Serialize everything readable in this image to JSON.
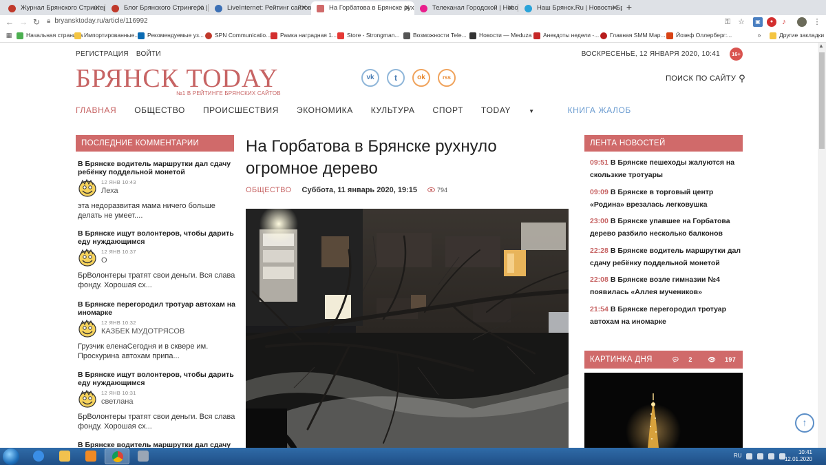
{
  "browser": {
    "tabs": [
      {
        "title": "Журнал Брянского Стрингера",
        "color": "#c0392b"
      },
      {
        "title": "Блог Брянского Стрингера | Янде",
        "color": "#c0392b"
      },
      {
        "title": "LiveInternet: Рейтинг сайтов",
        "color": "#3b6fb5"
      },
      {
        "title": "На Горбатова в Брянске рухнуло",
        "color": "#d06a6a"
      },
      {
        "title": "Телеканал Городской | Новости Бр",
        "color": "#e91e8c"
      },
      {
        "title": "Наш Брянск.Ru | Новости Брянск",
        "color": "#29a3d9"
      }
    ],
    "new_tab": "+",
    "url": "bryansktoday.ru/article/116992",
    "bookmarks": [
      {
        "label": "Начальная страница",
        "color": "#4caf50"
      },
      {
        "label": "Импортированные...",
        "color": "#f4c542"
      },
      {
        "label": "Рекомендуемые уз...",
        "color": "#0a6bb3"
      },
      {
        "label": "SPN Communicatio...",
        "color": "#c0392b"
      },
      {
        "label": "Рамка наградная 1...",
        "color": "#d32f2f"
      },
      {
        "label": "Store - Strongman...",
        "color": "#e53935"
      },
      {
        "label": "Возможности Tele...",
        "color": "#555555"
      },
      {
        "label": "Новости — Meduza",
        "color": "#333333"
      },
      {
        "label": "Анекдоты недели -...",
        "color": "#c62828"
      },
      {
        "label": "Главная SMM Мар...",
        "color": "#b71c1c"
      },
      {
        "label": "Йозеф Оллерберг:...",
        "color": "#d84315"
      },
      {
        "label": "Другие закладки",
        "color": "#f4c542"
      }
    ]
  },
  "header": {
    "register": "РЕГИСТРАЦИЯ",
    "login": "ВОЙТИ",
    "date": "ВОСКРЕСЕНЬЕ, 12 ЯНВАРЯ 2020, 10:41",
    "age_badge": "16+",
    "logo": "БРЯНСК TODAY",
    "tagline": "№1 В РЕЙТИНГЕ БРЯНСКИХ САЙТОВ",
    "social": [
      {
        "name": "vk",
        "glyph": "vk"
      },
      {
        "name": "twitter",
        "glyph": "t"
      },
      {
        "name": "odnoklassniki",
        "glyph": "ok"
      },
      {
        "name": "rss",
        "glyph": "rss"
      }
    ],
    "search": "ПОИСК ПО САЙТУ"
  },
  "nav": {
    "home": "ГЛАВНАЯ",
    "society": "ОБЩЕСТВО",
    "incidents": "ПРОИСШЕСТВИЯ",
    "economy": "ЭКОНОМИКА",
    "culture": "КУЛЬТУРА",
    "sport": "СПОРТ",
    "today": "TODAY",
    "complaints": "КНИГА ЖАЛОБ"
  },
  "comments": {
    "heading": "ПОСЛЕДНИЕ КОММЕНТАРИИ",
    "items": [
      {
        "title": "В Брянске водитель маршрутки дал сдачу ребёнку поддельной монетой",
        "date": "12 ЯНВ 10:43",
        "author": "Леха",
        "text": "эта недоразвитая мама ничего больше делать не умеет...."
      },
      {
        "title": "В Брянске ищут волонтеров, чтобы дарить еду нуждающимся",
        "date": "12 ЯНВ 10:37",
        "author": "О",
        "text": "БрВолонтеры тратят свои деньги. Вся слава фонду. Хорошая сх..."
      },
      {
        "title": "В Брянске перегородил тротуар автохам на иномарке",
        "date": "12 ЯНВ 10:32",
        "author": "КАЗБЕК МУДОТРЯСОВ",
        "text": "Грузчик еленаСегодня и в сквере им. Проскурина автохам припа..."
      },
      {
        "title": "В Брянске ищут волонтеров, чтобы дарить еду нуждающимся",
        "date": "12 ЯНВ 10:31",
        "author": "светлана",
        "text": "БрВолонтеры тратят свои деньги. Вся слава фонду. Хорошая сх..."
      },
      {
        "title": "В Брянске водитель маршрутки дал сдачу",
        "date": "",
        "author": "",
        "text": ""
      }
    ]
  },
  "article": {
    "title": "На Горбатова в Брянске рухнуло огромное дерево",
    "category": "ОБЩЕСТВО",
    "datetime": "Суббота, 11 январь 2020, 19:15",
    "views": "794"
  },
  "newsfeed": {
    "heading": "ЛЕНТА НОВОСТЕЙ",
    "items": [
      {
        "time": "09:51",
        "title": "В Брянске пешеходы жалуются на скользкие тротуары"
      },
      {
        "time": "09:09",
        "title": "В Брянске в торговый центр «Родина» врезалась легковушка"
      },
      {
        "time": "23:00",
        "title": "В Брянске упавшее на Горбатова дерево разбило несколько балконов"
      },
      {
        "time": "22:28",
        "title": "В Брянске водитель маршрутки дал сдачу ребёнку поддельной монетой"
      },
      {
        "time": "22:08",
        "title": "В Брянске возле гимназии №4 появилась «Аллея мучеников»"
      },
      {
        "time": "21:54",
        "title": "В Брянске перегородил тротуар автохам на иномарке"
      }
    ]
  },
  "picture_of_day": {
    "heading": "КАРТИНКА ДНЯ",
    "comments": "2",
    "views": "197"
  },
  "taskbar": {
    "lang": "RU",
    "time": "10:41",
    "date": "12.01.2020"
  }
}
